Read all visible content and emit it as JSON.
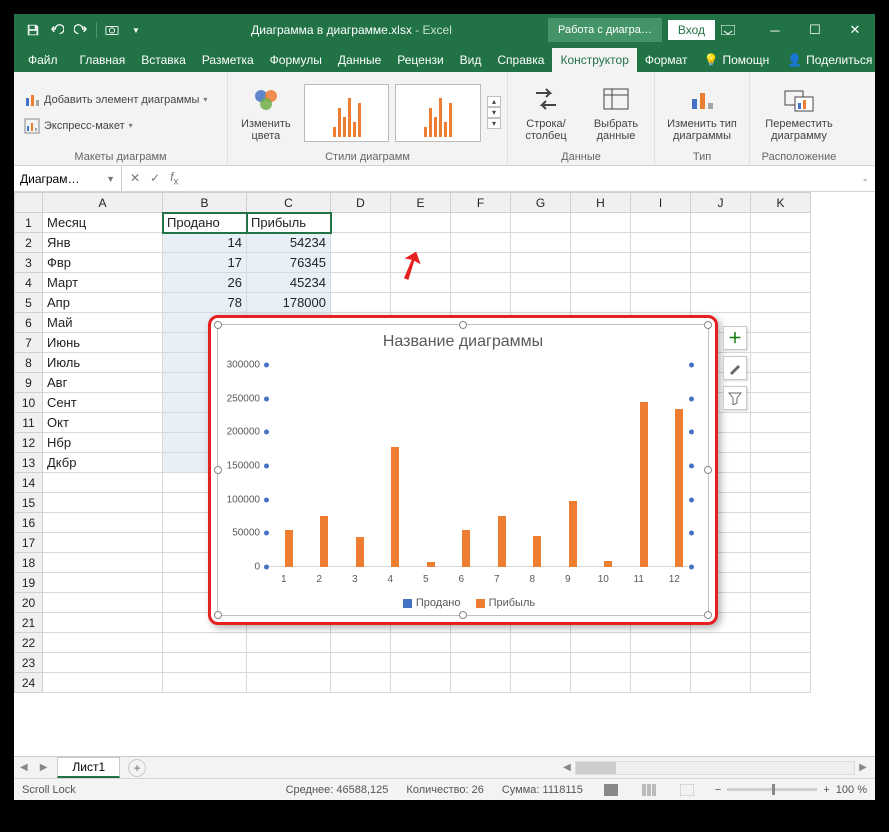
{
  "title": {
    "file": "Диаграмма в диаграмме.xlsx",
    "app": "Excel",
    "chart_tools": "Работа с диагра…",
    "signin": "Вход"
  },
  "tabs": {
    "file": "Файл",
    "list": [
      "Главная",
      "Вставка",
      "Разметка",
      "Формулы",
      "Данные",
      "Рецензи",
      "Вид",
      "Справка"
    ],
    "active": "Конструктор",
    "format": "Формат",
    "tell": "Помощн",
    "share": "Поделиться"
  },
  "ribbon": {
    "layouts": {
      "add": "Добавить элемент диаграммы",
      "quick": "Экспресс-макет",
      "label": "Макеты диаграмм"
    },
    "colors": {
      "btn": "Изменить цвета",
      "label_styles": "Стили диаграмм"
    },
    "data": {
      "switch": "Строка/ столбец",
      "select": "Выбрать данные",
      "label": "Данные"
    },
    "type": {
      "change": "Изменить тип диаграммы",
      "label": "Тип"
    },
    "loc": {
      "move": "Переместить диаграмму",
      "label": "Расположение"
    }
  },
  "fx": {
    "name": "Диаграм…"
  },
  "columns": [
    "A",
    "B",
    "C",
    "D",
    "E",
    "F",
    "G",
    "H",
    "I",
    "J",
    "K"
  ],
  "headers": {
    "a": "Месяц",
    "b": "Продано",
    "c": "Прибыль"
  },
  "rows": [
    {
      "m": "Янв",
      "s": "14",
      "p": "54234"
    },
    {
      "m": "Фвр",
      "s": "17",
      "p": "76345"
    },
    {
      "m": "Март",
      "s": "26",
      "p": "45234"
    },
    {
      "m": "Апр",
      "s": "78",
      "p": "178000"
    },
    {
      "m": "Май",
      "s": "",
      "p": ""
    },
    {
      "m": "Июнь",
      "s": "",
      "p": ""
    },
    {
      "m": "Июль",
      "s": "",
      "p": ""
    },
    {
      "m": "Авг",
      "s": "",
      "p": ""
    },
    {
      "m": "Сент",
      "s": "",
      "p": ""
    },
    {
      "m": "Окт",
      "s": "",
      "p": ""
    },
    {
      "m": "Нбр",
      "s": "",
      "p": ""
    },
    {
      "m": "Дкбр",
      "s": "",
      "p": ""
    }
  ],
  "chart_data": {
    "type": "bar",
    "title": "Название диаграммы",
    "categories": [
      "1",
      "2",
      "3",
      "4",
      "5",
      "6",
      "7",
      "8",
      "9",
      "10",
      "11",
      "12"
    ],
    "series": [
      {
        "name": "Продано",
        "color": "#4472c4",
        "values": [
          14,
          17,
          26,
          78,
          0,
          0,
          0,
          0,
          0,
          0,
          0,
          0
        ]
      },
      {
        "name": "Прибыль",
        "color": "#ed7d31",
        "values": [
          54234,
          76345,
          45234,
          178000,
          8000,
          55000,
          76000,
          46000,
          98000,
          9000,
          245000,
          235000
        ]
      }
    ],
    "ylim": [
      0,
      300000
    ],
    "yticks": [
      0,
      50000,
      100000,
      150000,
      200000,
      250000,
      300000
    ]
  },
  "sheet": {
    "name": "Лист1"
  },
  "status": {
    "mode": "Scroll Lock",
    "avg_l": "Среднее:",
    "avg": "46588,125",
    "cnt_l": "Количество:",
    "cnt": "26",
    "sum_l": "Сумма:",
    "sum": "1118115",
    "zoom": "100 %"
  }
}
